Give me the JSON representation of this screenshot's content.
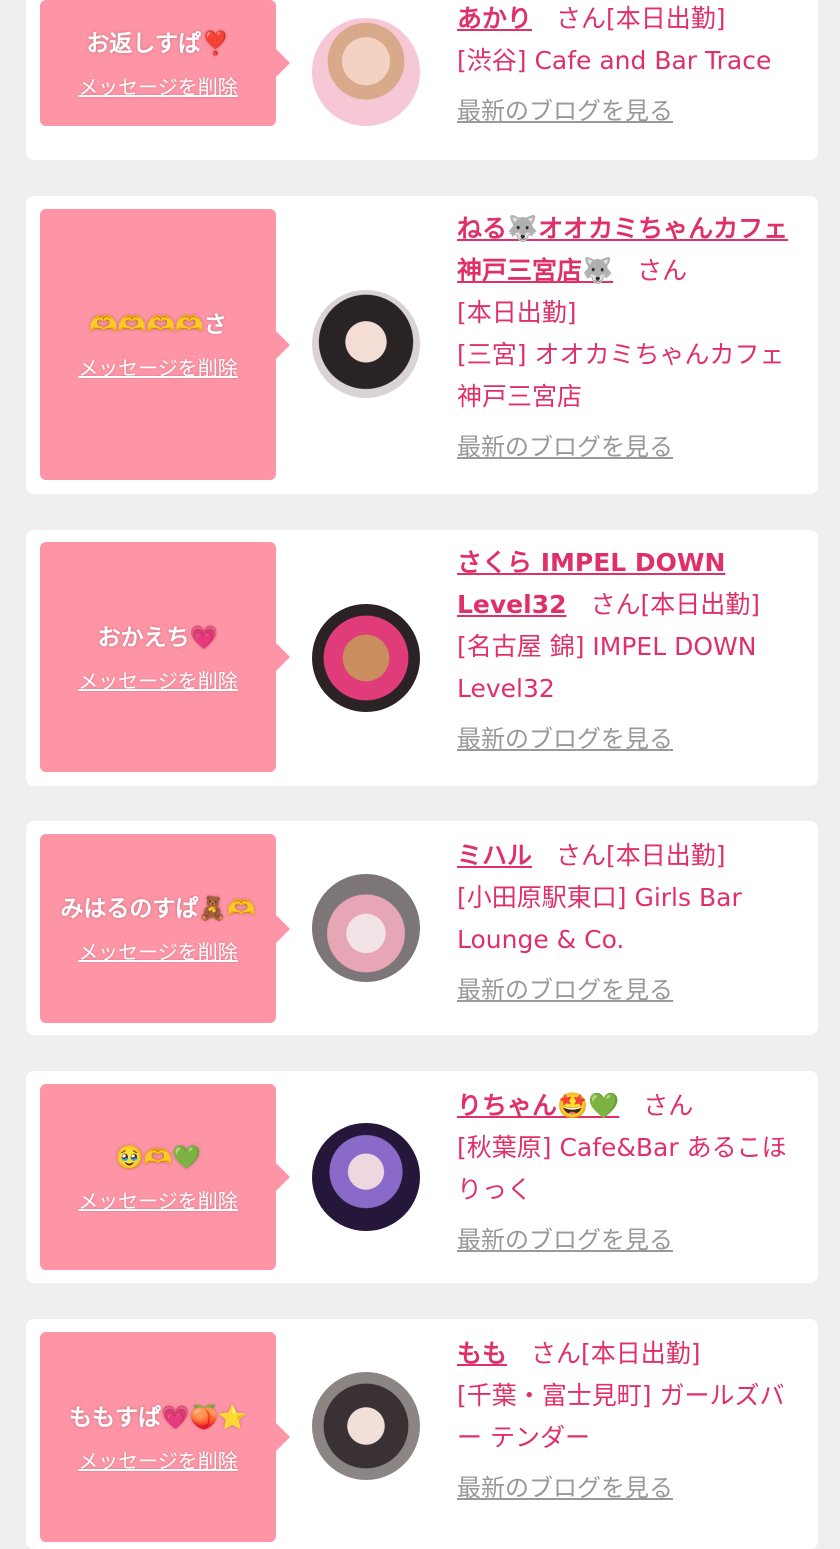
{
  "colors": {
    "accent": "#e0306a",
    "bubble": "#fe95a6",
    "link_gray": "#999999"
  },
  "items": [
    {
      "message": "お返しすぱ❣️",
      "delete_label": "メッセージを削除",
      "name": "あかり",
      "san": "さん",
      "status": "[本日出勤]",
      "location": "[渋谷] Cafe and Bar Trace",
      "blog_label": "最新のブログを見る"
    },
    {
      "message": "🫶🫶🫶🫶さ",
      "delete_label": "メッセージを削除",
      "name": "ねる🐺オオカミちゃんカフェ神戸三宮店🐺",
      "san": "さん",
      "status": "[本日出勤]",
      "location": "[三宮] オオカミちゃんカフェ神戸三宮店",
      "blog_label": "最新のブログを見る"
    },
    {
      "message": "おかえち💗",
      "delete_label": "メッセージを削除",
      "name": "さくら IMPEL DOWN Level32",
      "san": "さん",
      "status": "[本日出勤]",
      "location": "[名古屋 錦] IMPEL DOWN Level32",
      "blog_label": "最新のブログを見る"
    },
    {
      "message": "みはるのすぱ🧸🫶",
      "delete_label": "メッセージを削除",
      "name": "ミハル",
      "san": "さん",
      "status": "[本日出勤]",
      "location": "[小田原駅東口] Girls Bar Lounge & Co.",
      "blog_label": "最新のブログを見る"
    },
    {
      "message": "🥹🫶💚",
      "delete_label": "メッセージを削除",
      "name": "りちゃん🤩💚",
      "san": "さん",
      "status": "",
      "location": "[秋葉原] Cafe&Bar あるこほりっく",
      "blog_label": "最新のブログを見る"
    },
    {
      "message": "ももすぱ💗🍑⭐️",
      "delete_label": "メッセージを削除",
      "name": "もも",
      "san": "さん",
      "status": "[本日出勤]",
      "location": "[千葉・富士見町] ガールズバー テンダー",
      "blog_label": "最新のブログを見る"
    }
  ]
}
